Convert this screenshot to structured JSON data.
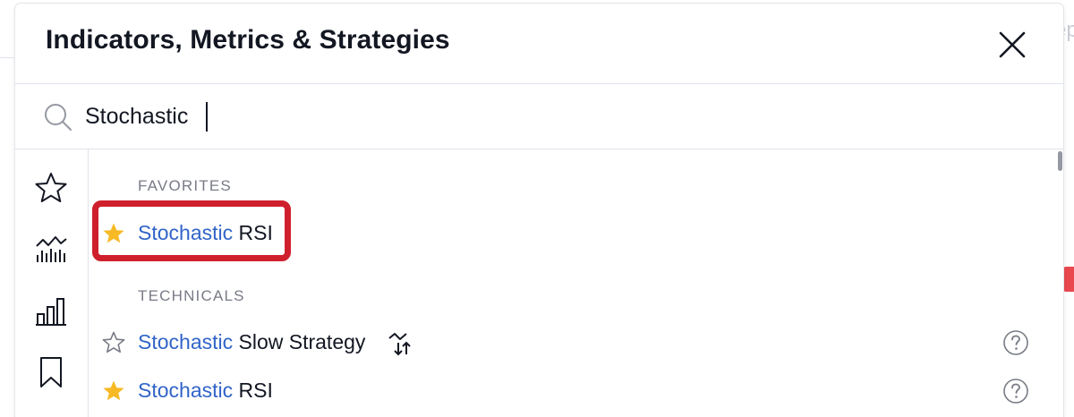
{
  "background": {
    "edge_text": "ep"
  },
  "dialog": {
    "title": "Indicators, Metrics & Strategies",
    "close_icon": "close-icon"
  },
  "search": {
    "icon": "search-icon",
    "value": "Stochastic",
    "placeholder": ""
  },
  "sidebar": {
    "items": [
      {
        "icon": "star-outline-icon",
        "id": "favorites"
      },
      {
        "icon": "chart-line-icon",
        "id": "technicals"
      },
      {
        "icon": "bar-chart-icon",
        "id": "financials"
      },
      {
        "icon": "bookmark-icon",
        "id": "my-scripts"
      }
    ]
  },
  "sections": {
    "favorites": {
      "header": "FAVORITES",
      "items": [
        {
          "highlight": "Stochastic",
          "rest": " RSI",
          "favorited": true
        }
      ]
    },
    "technicals": {
      "header": "TECHNICALS",
      "items": [
        {
          "highlight": "Stochastic",
          "rest": " Slow Strategy",
          "favorited": false,
          "strategy": true
        },
        {
          "highlight": "Stochastic",
          "rest": " RSI",
          "favorited": true,
          "strategy": false
        }
      ]
    }
  },
  "colors": {
    "highlight_text": "#3064c8",
    "star_filled": "#f7b924",
    "annotation_border": "#cf1f2c"
  }
}
